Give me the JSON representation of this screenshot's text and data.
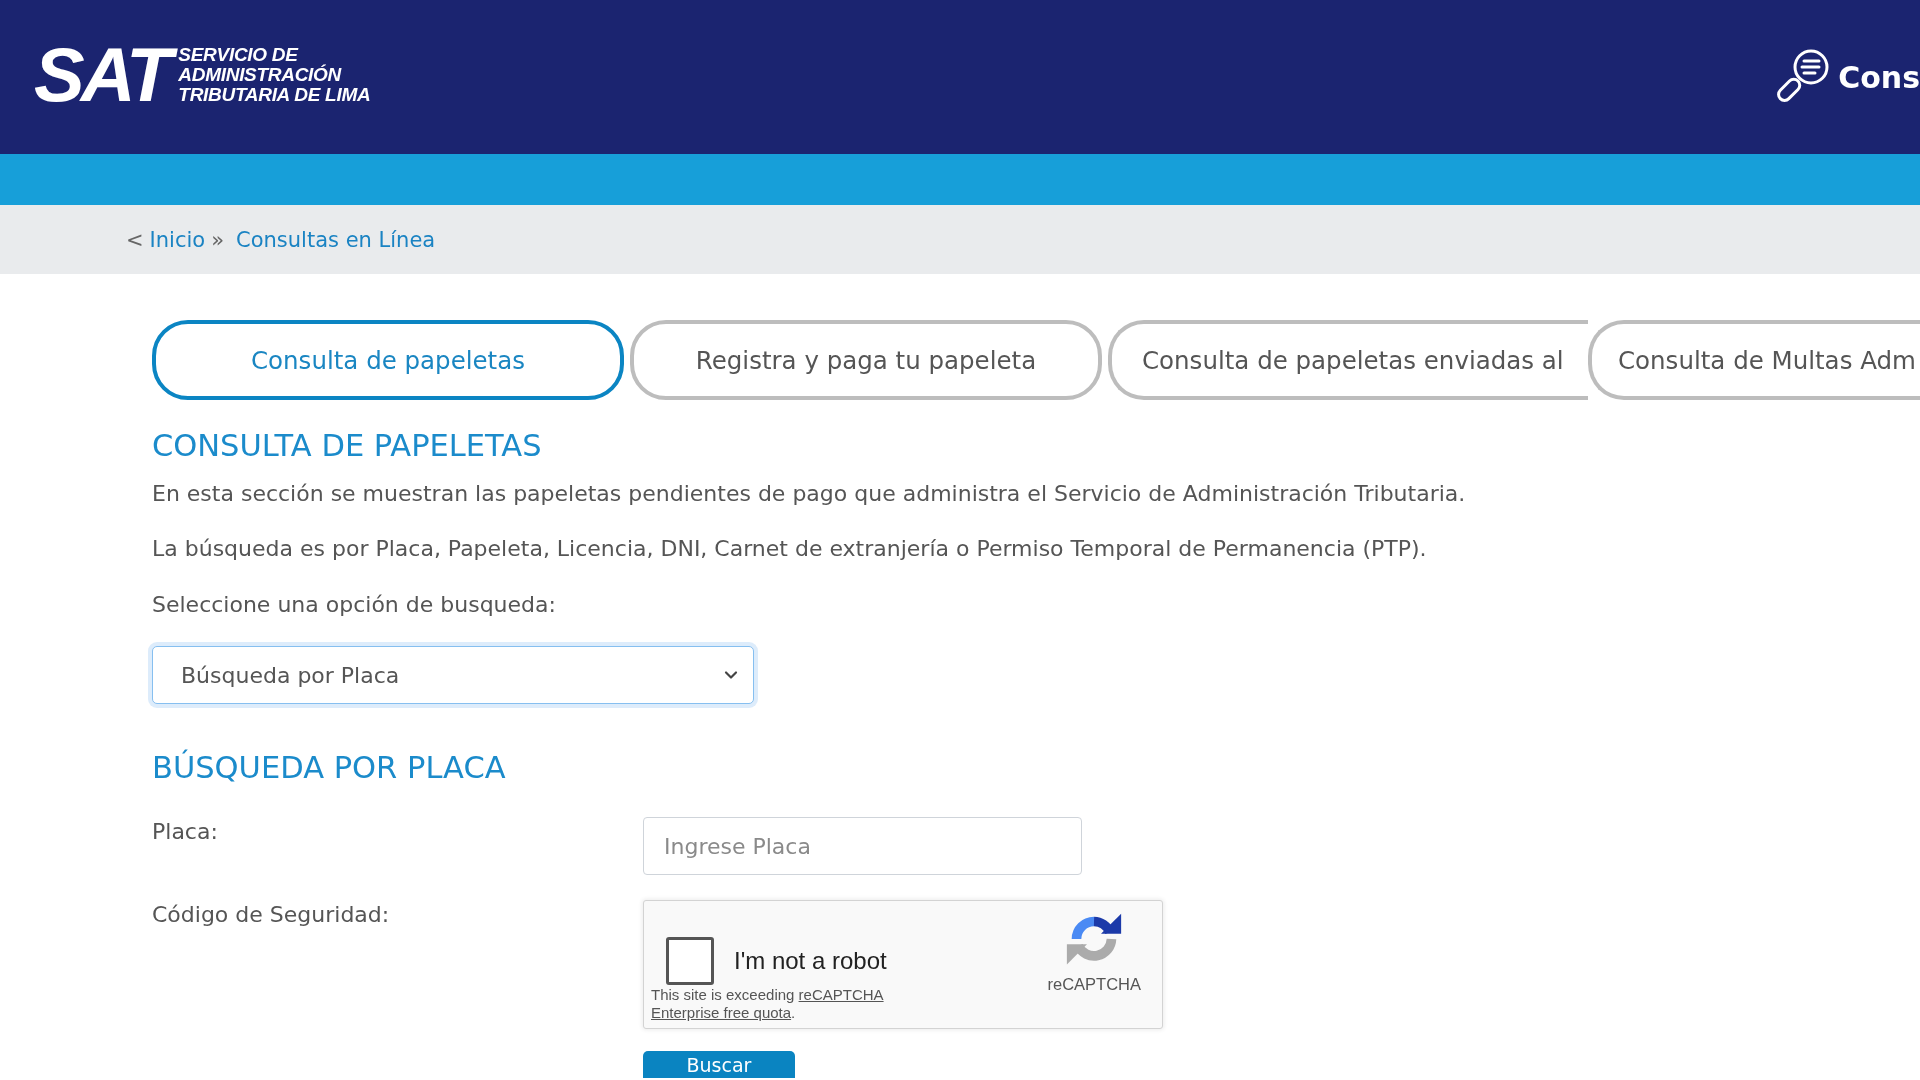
{
  "header": {
    "logo": {
      "mark": "SAT",
      "lines": [
        "SERVICIO DE",
        "ADMINISTRACIÓN",
        "TRIBUTARIA DE LIMA"
      ]
    },
    "menu_label": "Cons"
  },
  "breadcrumb": {
    "back": "<",
    "separator": "»",
    "items": [
      "Inicio",
      "Consultas en Línea"
    ]
  },
  "tabs": [
    {
      "label": "Consulta de papeletas",
      "selected": true
    },
    {
      "label": "Registra y paga tu papeleta",
      "selected": false
    },
    {
      "label": "Consulta de papeletas enviadas al",
      "selected": false
    },
    {
      "label": "Consulta de Multas Adm",
      "selected": false
    }
  ],
  "section": {
    "title": "CONSULTA DE PAPELETAS",
    "paragraphs": [
      "En esta sección se muestran las papeletas pendientes de pago que administra el Servicio de Administración Tributaria.",
      "La búsqueda es por Placa, Papeleta, Licencia, DNI, Carnet de extranjería o Permiso Temporal de Permanencia (PTP)."
    ],
    "select_label": "Seleccione una opción de busqueda:",
    "select": {
      "value": "Búsqueda por Placa",
      "focused": true
    }
  },
  "form": {
    "title": "BÚSQUEDA POR PLACA",
    "fields": [
      {
        "kind": "input",
        "label": "Placa:",
        "placeholder": "Ingrese Placa"
      },
      {
        "kind": "captcha",
        "label": "Código de Seguridad:",
        "captcha": {
          "label": "I'm not a robot",
          "checked": false,
          "brand": "reCAPTCHA",
          "notice": {
            "text": "This site is exceeding",
            "link_lines": [
              "reCAPTCHA",
              "Enterprise free quota"
            ],
            "end": "."
          }
        }
      }
    ],
    "submit": "Buscar"
  }
}
